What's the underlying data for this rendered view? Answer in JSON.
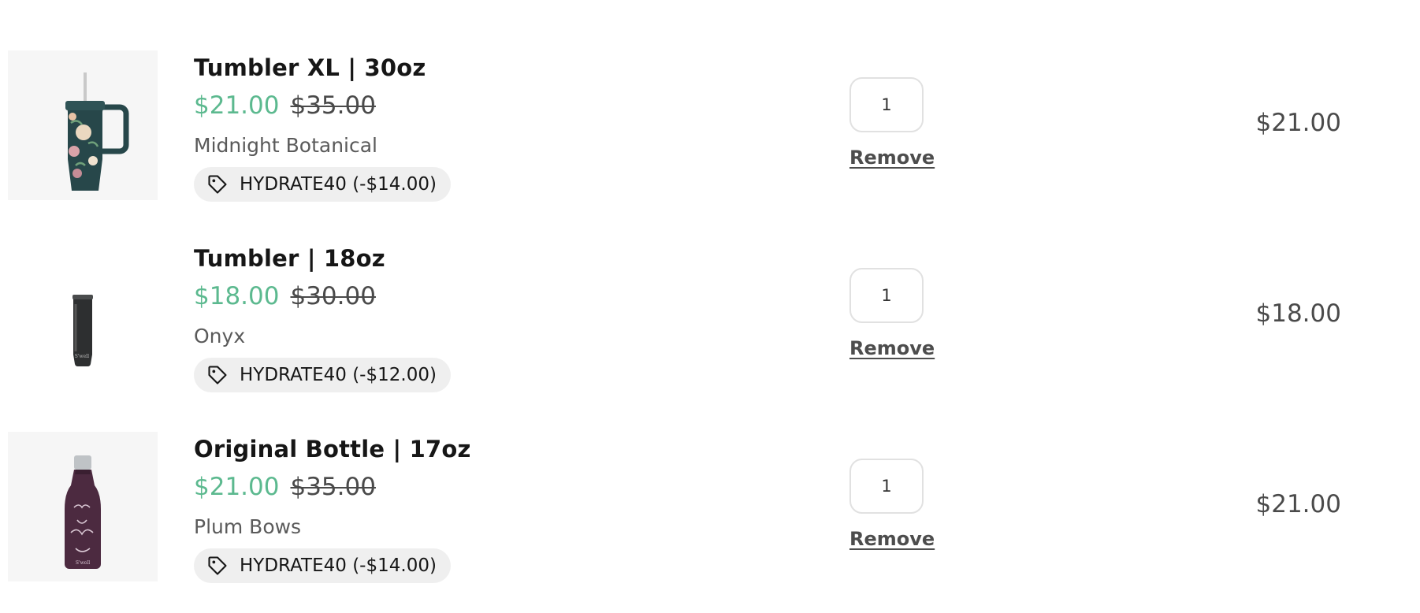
{
  "cart": {
    "items": [
      {
        "title": "Tumbler XL | 30oz",
        "sale_price": "$21.00",
        "compare_price": "$35.00",
        "variant": "Midnight Botanical",
        "discount": "HYDRATE40 (-$14.00)",
        "quantity": "1",
        "remove_label": "Remove",
        "line_total": "$21.00",
        "image_icon": "tumbler-xl-image"
      },
      {
        "title": "Tumbler | 18oz",
        "sale_price": "$18.00",
        "compare_price": "$30.00",
        "variant": "Onyx",
        "discount": "HYDRATE40 (-$12.00)",
        "quantity": "1",
        "remove_label": "Remove",
        "line_total": "$18.00",
        "image_icon": "tumbler-image"
      },
      {
        "title": "Original Bottle | 17oz",
        "sale_price": "$21.00",
        "compare_price": "$35.00",
        "variant": "Plum Bows",
        "discount": "HYDRATE40 (-$14.00)",
        "quantity": "1",
        "remove_label": "Remove",
        "line_total": "$21.00",
        "image_icon": "bottle-image"
      }
    ]
  },
  "colors": {
    "sale_price": "#5cb98f",
    "discount_pill": "#efefef",
    "text_primary": "#161616",
    "text_secondary": "#5a5a5a"
  },
  "icons": {
    "discount": "price-tag-icon"
  }
}
